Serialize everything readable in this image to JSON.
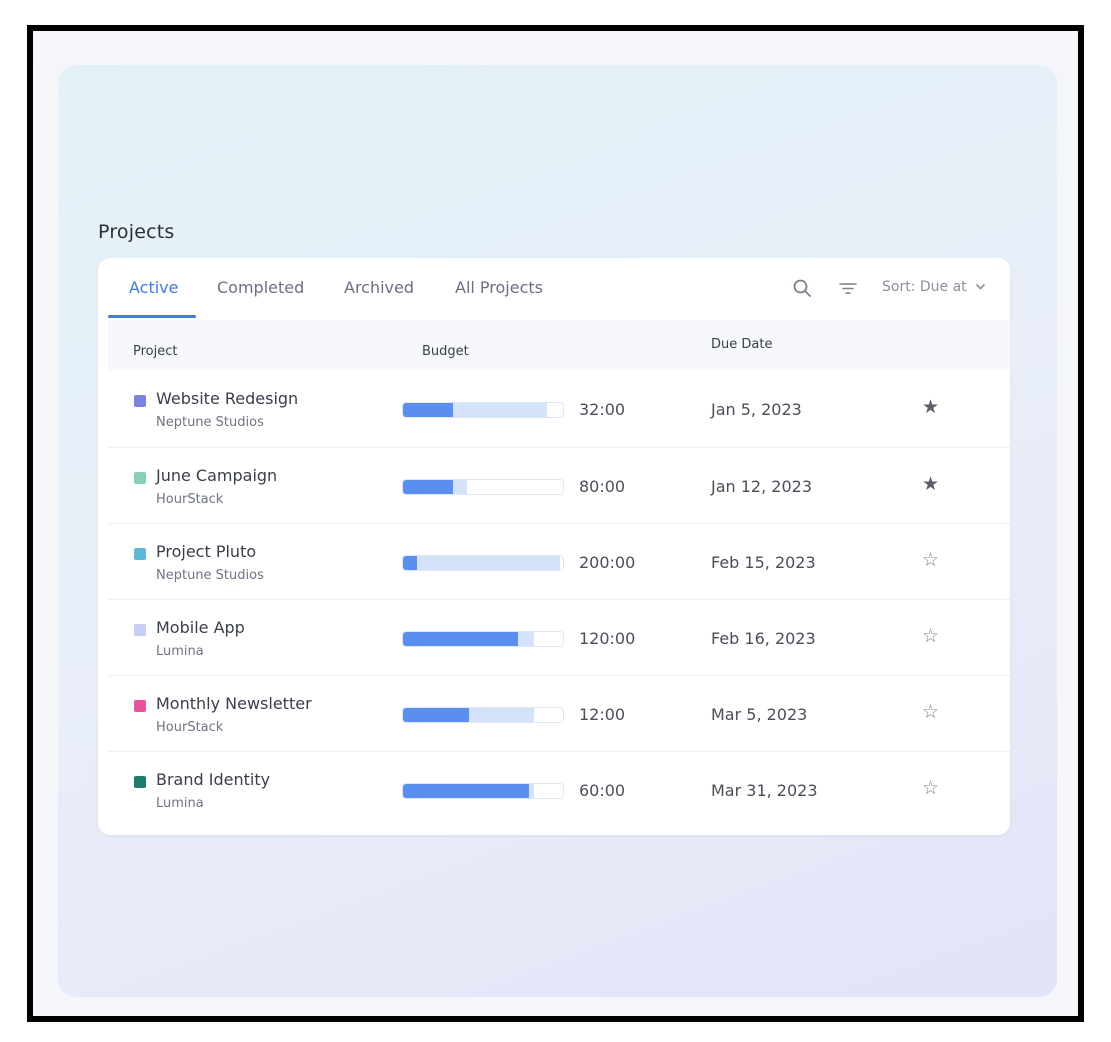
{
  "page": {
    "title": "Projects"
  },
  "tabs": [
    {
      "label": "Active",
      "active": true
    },
    {
      "label": "Completed",
      "active": false
    },
    {
      "label": "Archived",
      "active": false
    },
    {
      "label": "All Projects",
      "active": false
    }
  ],
  "toolbar": {
    "search_icon": "search-icon",
    "filter_icon": "filter-icon",
    "sort_label": "Sort: Due at",
    "sort_icon": "chevron-down-icon"
  },
  "table": {
    "columns": {
      "project": "Project",
      "budget": "Budget",
      "due_date": "Due Date"
    },
    "rows": [
      {
        "name": "Website Redesign",
        "client": "Neptune Studios",
        "color": "#7b83e0",
        "budget_used": 0.31,
        "budget_total": 0.9,
        "hours": "32:00",
        "due": "Jan 5, 2023",
        "starred": true,
        "star": "★"
      },
      {
        "name": "June Campaign",
        "client": "HourStack",
        "color": "#86d2b8",
        "budget_used": 0.31,
        "budget_total": 0.4,
        "hours": "80:00",
        "due": "Jan 12, 2023",
        "starred": true,
        "star": "★"
      },
      {
        "name": "Project Pluto",
        "client": "Neptune Studios",
        "color": "#5ab8d8",
        "budget_used": 0.09,
        "budget_total": 0.98,
        "hours": "200:00",
        "due": "Feb 15, 2023",
        "starred": false,
        "star": "☆"
      },
      {
        "name": "Mobile App",
        "client": "Lumina",
        "color": "#c5cff5",
        "budget_used": 0.72,
        "budget_total": 0.82,
        "hours": "120:00",
        "due": "Feb 16, 2023",
        "starred": false,
        "star": "☆"
      },
      {
        "name": "Monthly Newsletter",
        "client": "HourStack",
        "color": "#e8529b",
        "budget_used": 0.41,
        "budget_total": 0.82,
        "hours": "12:00",
        "due": "Mar 5, 2023",
        "starred": false,
        "star": "☆"
      },
      {
        "name": "Brand Identity",
        "client": "Lumina",
        "color": "#1e7d6a",
        "budget_used": 0.79,
        "budget_total": 0.82,
        "hours": "60:00",
        "due": "Mar 31, 2023",
        "starred": false,
        "star": "☆"
      }
    ]
  },
  "colors": {
    "accent": "#3d7ce2",
    "bar_fill": "#5a8ff0",
    "bar_track": "#d4e3fa"
  }
}
